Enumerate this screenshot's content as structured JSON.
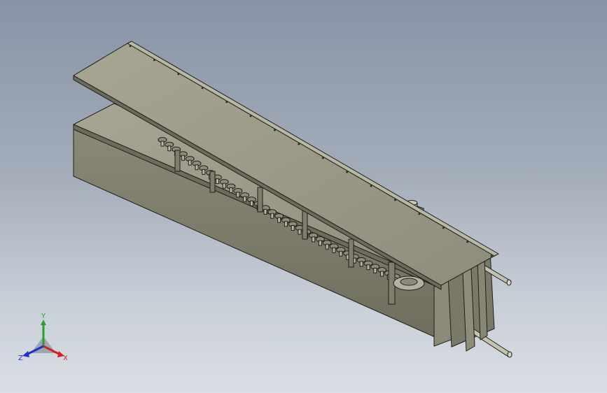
{
  "viewport": {
    "background_top": "#8794a6",
    "background_bottom": "#dadfe5"
  },
  "model": {
    "part_color": "#9a9a86",
    "edge_color": "#1e1e1a",
    "chain_link_count": 36
  },
  "triad": {
    "x_label": "X",
    "y_label": "Y",
    "z_label": "Z",
    "x_color": "#d42020",
    "y_color": "#2aa02a",
    "z_color": "#2030c8"
  }
}
